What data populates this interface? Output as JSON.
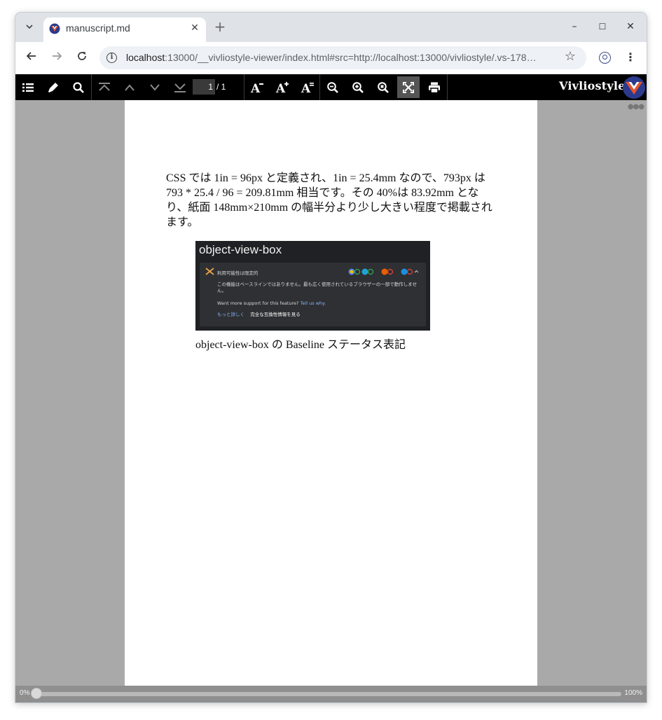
{
  "browser": {
    "tab": {
      "title": "manuscript.md",
      "close_glyph": "✕"
    },
    "new_tab_glyph": "+",
    "window_controls": {
      "minimize": "–",
      "maximize": "☐",
      "close": "✕"
    },
    "url": {
      "host": "localhost",
      "rest": ":13000/__vivliostyle-viewer/index.html#src=http://localhost:13000/vivliostyle/.vs-178…"
    },
    "icons": [
      "tab-search-icon",
      "back-icon",
      "forward-icon",
      "reload-icon",
      "info-icon",
      "star-icon",
      "profile-icon",
      "menu-icon"
    ]
  },
  "viewer_toolbar": {
    "page_current": "1",
    "page_total": "/ 1",
    "brand": "Vivliostyle",
    "icons": [
      "toc-icon",
      "marker-icon",
      "search-icon",
      "first-page-icon",
      "prev-page-icon",
      "next-page-icon",
      "last-page-icon",
      "font-smaller-icon",
      "font-larger-icon",
      "font-default-icon",
      "zoom-out-icon",
      "zoom-in-icon",
      "zoom-fit-icon",
      "fullscreen-icon",
      "print-icon"
    ]
  },
  "document": {
    "paragraph": "CSS では 1in = 96px と定義され、1in = 25.4mm なので、793px は 793 * 25.4 / 96 = 209.81mm 相当です。その 40%は 83.92mm となり、紙面 148mm×210mm の幅半分より少し大きい程度で掲載されます。",
    "figure": {
      "image_title": "object-view-box",
      "limited_label": "利用可能性は限定的",
      "desc": "この機能はベースラインではありません。最も広く使用されているブラウザーの一部で動作しません。",
      "support_prompt": "Want more support for this feature?",
      "support_link": "Tell us why.",
      "learn_more": "もっと詳しく",
      "full_compat": "完全な互換性情報を見る",
      "caption": "object-view-box の Baseline ステータス表記"
    }
  },
  "progress": {
    "start_label": "0%",
    "end_label": "100%",
    "value": 0
  },
  "colors": {
    "viewer_bg": "#a9a9a9",
    "toolbar_bg": "#000000",
    "link": "#8ab4f8",
    "warn": "#e8a24a"
  }
}
